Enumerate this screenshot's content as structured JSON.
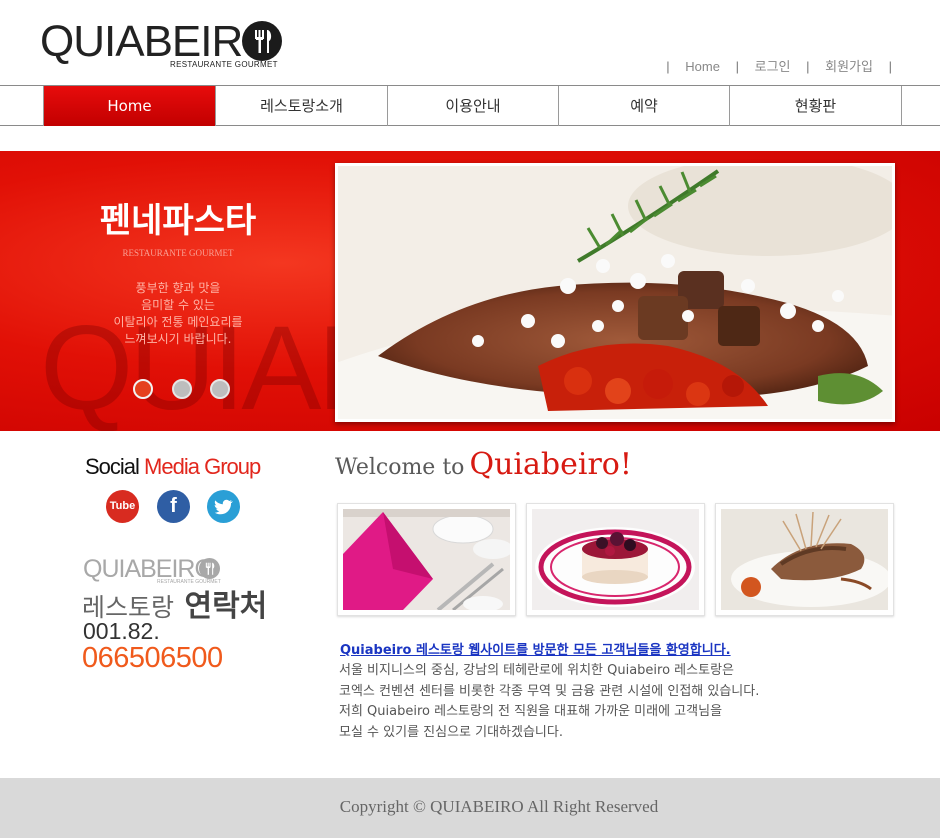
{
  "logo": {
    "text": "QUIABEIRO",
    "tagline": "RESTAURANTE GOURMET"
  },
  "topnav": [
    {
      "label": "Home"
    },
    {
      "label": "로그인"
    },
    {
      "label": "회원가입"
    }
  ],
  "mainnav": {
    "tabs": [
      {
        "label": "Home",
        "active": true
      },
      {
        "label": "레스토랑소개",
        "active": false
      },
      {
        "label": "이용안내",
        "active": false
      },
      {
        "label": "예약",
        "active": false
      },
      {
        "label": "현황판",
        "active": false
      }
    ]
  },
  "hero": {
    "watermark": "QUIABEIRO",
    "title": "펜네파스타",
    "subtitle": "RESTAURANTE GOURMET",
    "description_lines": [
      "풍부한 향과 맛을",
      "음미할 수 있는",
      "이탈리아 전통 메인요리를",
      "느껴보시기 바랍니다."
    ],
    "slide_count": 3,
    "active_slide": 1
  },
  "social": {
    "title_black": "Social",
    "title_red": "Media Group",
    "icons": [
      {
        "name": "youtube-icon",
        "label": "Tube"
      },
      {
        "name": "facebook-icon",
        "label": "f"
      },
      {
        "name": "twitter-icon",
        "label": "🐦"
      }
    ]
  },
  "contact": {
    "logo_text": "QUIABEIRO",
    "logo_tagline": "RESTAURANTE GOURMET",
    "title_light": "레스토랑",
    "title_bold": "연락처",
    "phone_prefix": "001.82.",
    "phone_number": "066506500"
  },
  "welcome": {
    "prefix": "Welcome to",
    "brand": "Quiabeiro!"
  },
  "intro": {
    "link_text": "Quiabeiro 레스토랑 웹사이트를 방문한 모든 고객님들을 환영합니다.",
    "lines": [
      "서울 비지니스의 중심, 강남의 테헤란로에 위치한 Quiabeiro 레스토랑은",
      "코엑스 컨벤션 센터를 비롯한 각종 무역 및 금융 관련 시설에 인접해 있습니다.",
      "저희 Quiabeiro 레스토랑의 전 직원을 대표해 가까운 미래에 고객님을",
      "모실 수 있기를 진심으로 기대하겠습니다."
    ]
  },
  "footer": {
    "copyright": "Copyright © QUIABEIRO All Right Reserved"
  },
  "colors": {
    "brand_red": "#e0120a",
    "accent_orange": "#f05a1c",
    "link_blue": "#1a35c2"
  }
}
